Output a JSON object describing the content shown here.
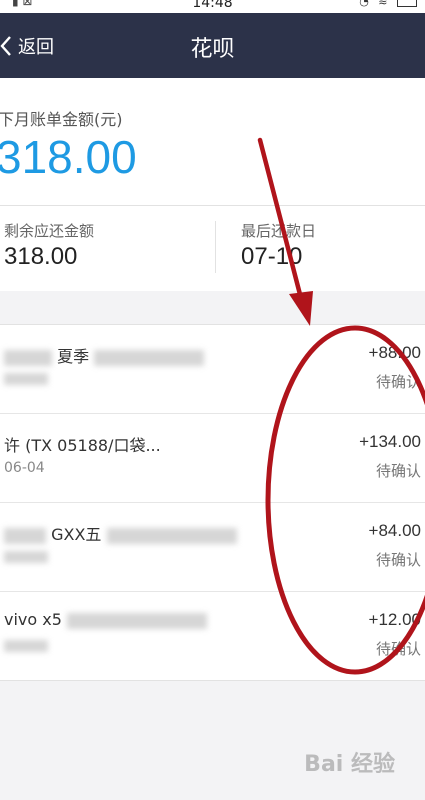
{
  "status_bar": {
    "time": "14:48"
  },
  "nav": {
    "back_label": "返回",
    "title": "花呗"
  },
  "summary": {
    "next_bill_label": "下月账单金额(元)",
    "next_bill_amount": "318.00",
    "remaining_label": "剩余应还金额",
    "remaining_amount": "318.00",
    "due_label": "最后还款日",
    "due_date": "07-10"
  },
  "transactions": [
    {
      "name": "夏季",
      "date": "",
      "amount": "+88.00",
      "status": "待确认"
    },
    {
      "name": "许    (TX  05188/口袋...",
      "date": "06-04",
      "amount": "+134.00",
      "status": "待确认"
    },
    {
      "name": "GXX五",
      "date": "",
      "amount": "+84.00",
      "status": "待确认"
    },
    {
      "name": "vivo x5",
      "date": "",
      "amount": "+12.00",
      "status": "待确认"
    }
  ],
  "annotation": {
    "arrow_color": "#b0141b",
    "ellipse_color": "#b0141b"
  },
  "watermark": "Bai 经验"
}
